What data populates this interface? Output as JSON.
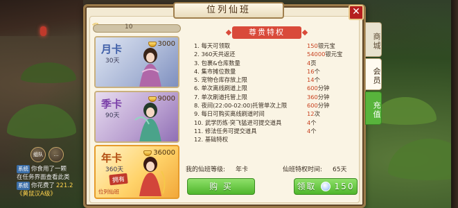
{
  "window": {
    "title": "位列仙班",
    "close_label": "✕"
  },
  "tabs": {
    "shop": "商城",
    "member": "会员",
    "recharge": "充值"
  },
  "level": {
    "value": "10"
  },
  "cards": [
    {
      "name": "月卡",
      "days": "30天",
      "price": "3000"
    },
    {
      "name": "季卡",
      "days": "90天",
      "price": "9000"
    },
    {
      "name": "年卡",
      "days": "360天",
      "price": "36000",
      "badge": "拥有",
      "tag": "位列仙班"
    }
  ],
  "privileges": {
    "title": "尊贵特权",
    "items": [
      {
        "label": "1. 每天可领取",
        "value": "150",
        "unit": "银元宝"
      },
      {
        "label": "2. 360天共返还",
        "value": "54000",
        "unit": "银元宝"
      },
      {
        "label": "3. 包裹&仓库数量",
        "value": "4",
        "unit": "页"
      },
      {
        "label": "4. 集市摊位数量",
        "value": "16",
        "unit": "个"
      },
      {
        "label": "5. 宠物仓库存放上限",
        "value": "14",
        "unit": "个"
      },
      {
        "label": "6. 单次离线刷道上限",
        "value": "600",
        "unit": "分钟"
      },
      {
        "label": "7. 单次刷道托管上限",
        "value": "360",
        "unit": "分钟"
      },
      {
        "label": "8. 夜间(22:00-02:00)托管单次上限",
        "value": "600",
        "unit": "分钟"
      },
      {
        "label": "9. 每日可购买离线刷道时间",
        "value": "12",
        "unit": "次"
      },
      {
        "label": "10. 武学历练·突飞猛进可提交道具",
        "value": "4",
        "unit": "个"
      },
      {
        "label": "11. 修法任务可提交道具",
        "value": "4",
        "unit": "个"
      },
      {
        "label": "12. 基础特权",
        "value": "",
        "unit": ""
      }
    ]
  },
  "member_info": {
    "level_label": "我的仙班等级:",
    "level_value": "年卡",
    "time_label": "仙班特权时间:",
    "time_value": "65天"
  },
  "buttons": {
    "buy": "购 买",
    "claim": "领取",
    "claim_amount": "150"
  },
  "chat": [
    {
      "tag": "系统",
      "text": "你食用了一颗"
    },
    {
      "tag": "",
      "text": "在任务界面查看此类"
    },
    {
      "tag": "系统",
      "text": "你花费了",
      "money": "221.2"
    },
    {
      "tag": "",
      "text": "《黄鼠汉A级》"
    }
  ],
  "left_buttons": {
    "team": "组队"
  },
  "colors": {
    "accent": "#d94a3a",
    "value_red": "#c8411f",
    "button_green": "#4fb62c"
  }
}
